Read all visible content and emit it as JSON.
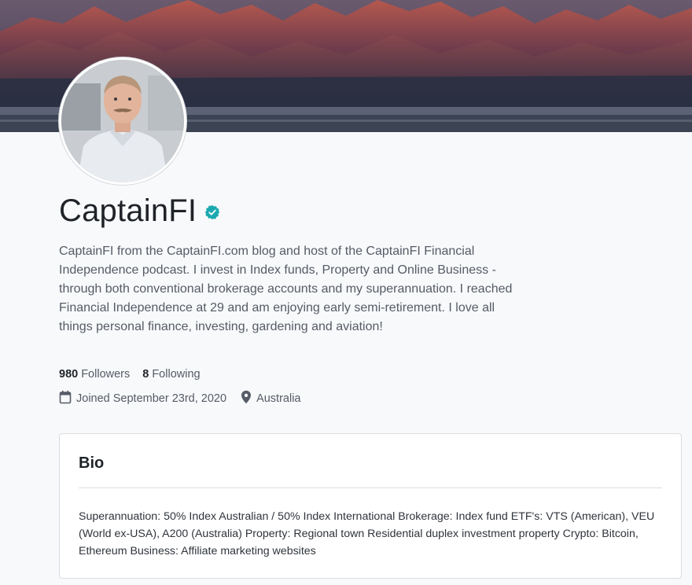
{
  "profile": {
    "name": "CaptainFI",
    "verified_icon": "verified-badge-icon",
    "description": "CaptainFI from the CaptainFI.com blog and host of the CaptainFI Financial Independence podcast. I invest in Index funds, Property and Online Business - through both conventional brokerage accounts and my superannuation. I reached Financial Independence at 29 and am enjoying early semi-retirement. I love all things personal finance, investing, gardening and aviation!",
    "followers_count": "980",
    "followers_label": "Followers",
    "following_count": "8",
    "following_label": "Following",
    "joined": "Joined September 23rd, 2020",
    "location": "Australia"
  },
  "bio": {
    "title": "Bio",
    "text": "Superannuation: 50% Index Australian / 50% Index International Brokerage: Index fund ETF's: VTS (American), VEU (World ex-USA), A200 (Australia) Property: Regional town Residential duplex investment property Crypto: Bitcoin, Ethereum Business: Affiliate marketing websites"
  },
  "colors": {
    "verified": "#1aa9b0",
    "background": "#f8f9fb",
    "text_primary": "#1f2328",
    "text_secondary": "#555b65"
  }
}
